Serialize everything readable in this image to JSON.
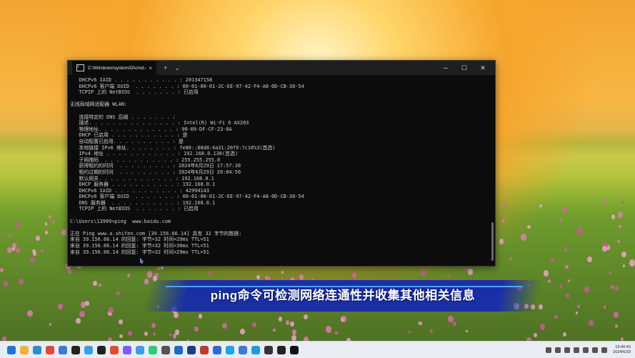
{
  "window": {
    "tab_title": "C:\\Windows\\system32\\cmd.e",
    "tab_close": "×",
    "new_tab": "+",
    "dropdown": "⌄",
    "minimize": "─",
    "maximize": "☐",
    "close": "✕"
  },
  "terminal_lines": [
    "   DHCPv6 IAID . . . . . . . . . . . : 201347158",
    "   DHCPv6 客户端 DUID  . . . . . . . : 00-01-00-01-2C-EE-97-42-F4-A8-0D-CB-38-54",
    "   TCPIP 上的 NetBIOS  . . . . . . . : 已启用",
    "",
    "无线局域网适配器 WLAN:",
    "",
    "   连接特定的 DNS 后缀 . . . . . . . :",
    "   描述. . . . . . . . . . . . . . . : Intel(R) Wi-Fi 6 AX203",
    "   物理地址. . . . . . . . . . . . . : 90-09-DF-CF-23-8A",
    "   DHCP 已启用 . . . . . . . . . . . : 是",
    "   自动配置已启用. . . . . . . . . . : 是",
    "   本地链接 IPv6 地址. . . . . . . . : fe80::88d8:4a31:20f9:7c10%3(首选)",
    "   IPv4 地址 . . . . . . . . . . . . : 192.168.0.138(首选)",
    "   子网掩码  . . . . . . . . . . . . : 255.255.255.0",
    "   获得租约的时间  . . . . . . . . . : 2024年6月29日 17:57:30",
    "   租约过期的时间  . . . . . . . . . : 2024年6月29日 20:04:50",
    "   默认网关. . . . . . . . . . . . . : 192.168.0.1",
    "   DHCP 服务器 . . . . . . . . . . . : 192.168.0.1",
    "   DHCPv6 IAID . . . . . . . . . . . : 42994143",
    "   DHCPv6 客户端 DUID  . . . . . . . : 00-01-00-01-2C-EE-97-42-F4-A8-0D-CB-38-54",
    "   DNS 服务器  . . . . . . . . . . . : 192.168.0.1",
    "   TCPIP 上的 NetBIOS  . . . . . . . : 已启用",
    "",
    "C:\\Users\\13909>ping  www.baidu.com",
    "",
    "正在 Ping www.a.shifen.com [39.156.66.14] 具有 32 字节的数据:",
    "来自 39.156.66.14 的回复: 字节=32 时间=29ms TTL=51",
    "来自 39.156.66.14 的回复: 字节=32 时间=30ms TTL=51",
    "来自 39.156.66.14 的回复: 字节=32 时间=29ms TTL=51"
  ],
  "caption": "ping命令可检测网络连通性并收集其他相关信息",
  "taskbar": {
    "time": "19:40:43",
    "date": "2024/6/29",
    "icon_colors": [
      "#1e74d8",
      "#f2b134",
      "#2a8cd6",
      "#e04a3b",
      "#3a7bd5",
      "#222222",
      "#3aa0e8",
      "#222222",
      "#e44d26",
      "#7a5cff",
      "#3d9be9",
      "#2ecc71",
      "#555555",
      "#1b6ad1",
      "#1e3a8a",
      "#c0392b",
      "#2a6bd1",
      "#1fa4e8",
      "#3a7bd5",
      "#1e9be0",
      "#333333",
      "#222222",
      "#111111"
    ],
    "icon_names": [
      "windows-start-icon",
      "file-explorer-icon",
      "edge-icon",
      "app-icon",
      "app-icon",
      "app-icon",
      "app-icon",
      "capcut-icon",
      "chrome-icon",
      "app-icon",
      "app-icon",
      "wechat-icon",
      "app-icon",
      "app-icon",
      "premiere-icon",
      "app-icon",
      "photoshop-icon",
      "app-icon",
      "app-icon",
      "app-icon",
      "app-icon",
      "terminal-icon",
      "capcut-icon"
    ]
  }
}
